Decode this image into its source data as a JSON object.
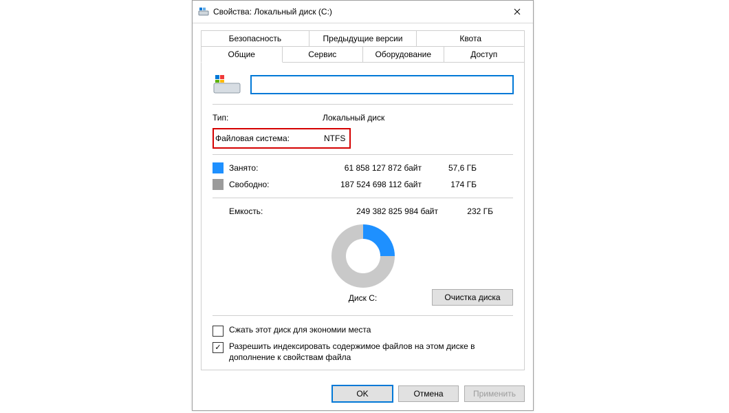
{
  "window": {
    "title": "Свойства: Локальный диск (C:)"
  },
  "tabs": {
    "row1": [
      "Безопасность",
      "Предыдущие версии",
      "Квота"
    ],
    "row2": [
      "Общие",
      "Сервис",
      "Оборудование",
      "Доступ"
    ]
  },
  "general": {
    "volume_label": "",
    "type_label": "Тип:",
    "type_value": "Локальный диск",
    "fs_label": "Файловая система:",
    "fs_value": "NTFS",
    "used": {
      "label": "Занято:",
      "bytes": "61 858 127 872 байт",
      "human": "57,6 ГБ"
    },
    "free": {
      "label": "Свободно:",
      "bytes": "187 524 698 112 байт",
      "human": "174 ГБ"
    },
    "capacity": {
      "label": "Емкость:",
      "bytes": "249 382 825 984 байт",
      "human": "232 ГБ"
    },
    "donut_caption": "Диск C:",
    "cleanup_button": "Очистка диска",
    "checks": {
      "compress": "Сжать этот диск для экономии места",
      "index": "Разрешить индексировать содержимое файлов на этом диске в дополнение к свойствам файла"
    }
  },
  "footer": {
    "ok": "OK",
    "cancel": "Отмена",
    "apply": "Применить"
  },
  "chart_data": {
    "type": "pie",
    "title": "Диск C:",
    "series": [
      {
        "name": "Занято",
        "value": 61858127872,
        "human": "57,6 ГБ",
        "color": "#1e90ff"
      },
      {
        "name": "Свободно",
        "value": 187524698112,
        "human": "174 ГБ",
        "color": "#c9c9c9"
      }
    ],
    "total": {
      "label": "Емкость",
      "value": 249382825984,
      "human": "232 ГБ"
    }
  }
}
